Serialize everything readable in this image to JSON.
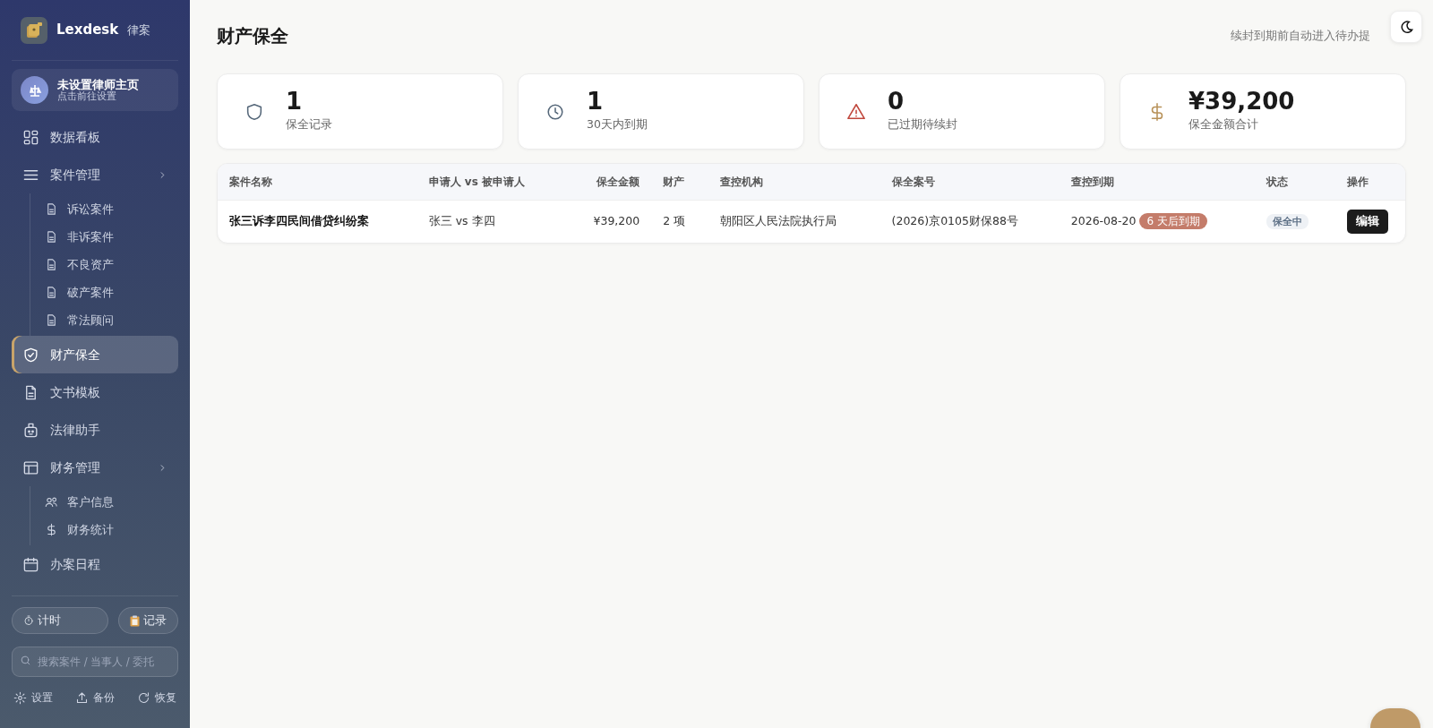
{
  "brand": {
    "name": "Lexdesk",
    "suffix": "律案"
  },
  "profile": {
    "title": "未设置律师主页",
    "subtitle": "点击前往设置"
  },
  "nav": [
    {
      "label": "数据看板",
      "selected": false
    },
    {
      "label": "案件管理",
      "selected": false,
      "expanded": true,
      "children": [
        {
          "label": "诉讼案件",
          "selected": false
        },
        {
          "label": "非诉案件",
          "selected": false
        },
        {
          "label": "不良资产",
          "selected": false
        },
        {
          "label": "破产案件",
          "selected": false
        },
        {
          "label": "常法顾问",
          "selected": false
        }
      ]
    },
    {
      "label": "财产保全",
      "selected": true
    },
    {
      "label": "文书模板",
      "selected": false
    },
    {
      "label": "法律助手",
      "selected": false
    },
    {
      "label": "财务管理",
      "selected": false,
      "expanded": true,
      "children": [
        {
          "label": "客户信息",
          "selected": false
        },
        {
          "label": "财务统计",
          "selected": false
        }
      ]
    },
    {
      "label": "办案日程",
      "selected": false
    }
  ],
  "tools": {
    "timer": "计时",
    "log": "记录"
  },
  "search": {
    "placeholder": "搜索案件 / 当事人 / 委托"
  },
  "footer": [
    "设置",
    "备份",
    "恢复"
  ],
  "page": {
    "title": "财产保全",
    "subtitle": "续封到期前自动进入待办提"
  },
  "stats": [
    {
      "kind": "shield",
      "value": "1",
      "label": "保全记录"
    },
    {
      "kind": "clock",
      "value": "1",
      "label": "30天内到期"
    },
    {
      "kind": "warning",
      "value": "0",
      "label": "已过期待续封"
    },
    {
      "kind": "money",
      "value": "¥39,200",
      "label": "保全金额合计"
    }
  ],
  "table": {
    "columns": [
      "案件名称",
      "申请人 vs 被申请人",
      "保全金额",
      "财产",
      "查控机构",
      "保全案号",
      "查控到期",
      "状态",
      "操作"
    ],
    "rows": [
      {
        "name": "张三诉李四民间借贷纠纷案",
        "parties": "张三 vs 李四",
        "amount": "¥39,200",
        "assets": "2 项",
        "authority": "朝阳区人民法院执行局",
        "case_no": "(2026)京0105财保88号",
        "due_date": "2026-08-20",
        "due_badge": "6 天后到期",
        "status": "保全中",
        "action": "编辑"
      }
    ]
  }
}
